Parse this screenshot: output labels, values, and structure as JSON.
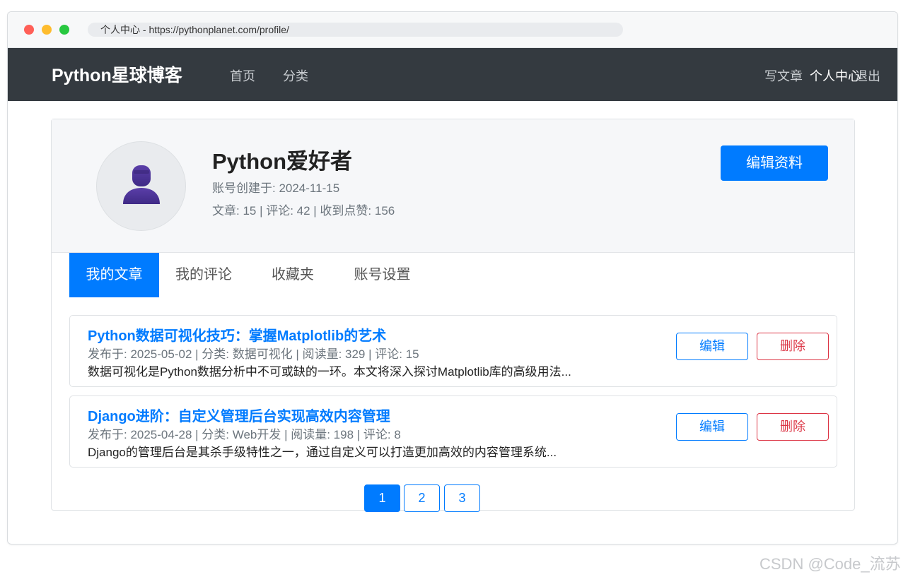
{
  "browser": {
    "url_text": "个人中心 - https://pythonplanet.com/profile/"
  },
  "navbar": {
    "brand": "Python星球博客",
    "links": [
      "首页",
      "分类"
    ],
    "right_links": [
      "写文章",
      "个人中心",
      "退出"
    ]
  },
  "profile": {
    "avatar_icon": "user-avatar-icon",
    "name": "Python爱好者",
    "created": "账号创建于: 2024-11-15",
    "stats": "文章: 15 | 评论: 42 | 收到点赞: 156",
    "edit_button": "编辑资料"
  },
  "tabs": [
    {
      "label": "我的文章",
      "active": true
    },
    {
      "label": "我的评论",
      "active": false
    },
    {
      "label": "收藏夹",
      "active": false
    },
    {
      "label": "账号设置",
      "active": false
    }
  ],
  "articles": [
    {
      "title": "Python数据可视化技巧：掌握Matplotlib的艺术",
      "meta": "发布于: 2025-05-02 | 分类: 数据可视化 | 阅读量: 329 | 评论: 15",
      "excerpt": "数据可视化是Python数据分析中不可或缺的一环。本文将深入探讨Matplotlib库的高级用法...",
      "edit_label": "编辑",
      "delete_label": "删除"
    },
    {
      "title": "Django进阶：自定义管理后台实现高效内容管理",
      "meta": "发布于: 2025-04-28 | 分类: Web开发 | 阅读量: 198 | 评论: 8",
      "excerpt": "Django的管理后台是其杀手级特性之一，通过自定义可以打造更加高效的内容管理系统...",
      "edit_label": "编辑",
      "delete_label": "删除"
    }
  ],
  "pagination": {
    "pages": [
      "1",
      "2",
      "3"
    ],
    "current": "1"
  },
  "watermark": "CSDN @Code_流苏",
  "colors": {
    "primary": "#007bff",
    "danger": "#dc3545",
    "navbar": "#343a40"
  }
}
